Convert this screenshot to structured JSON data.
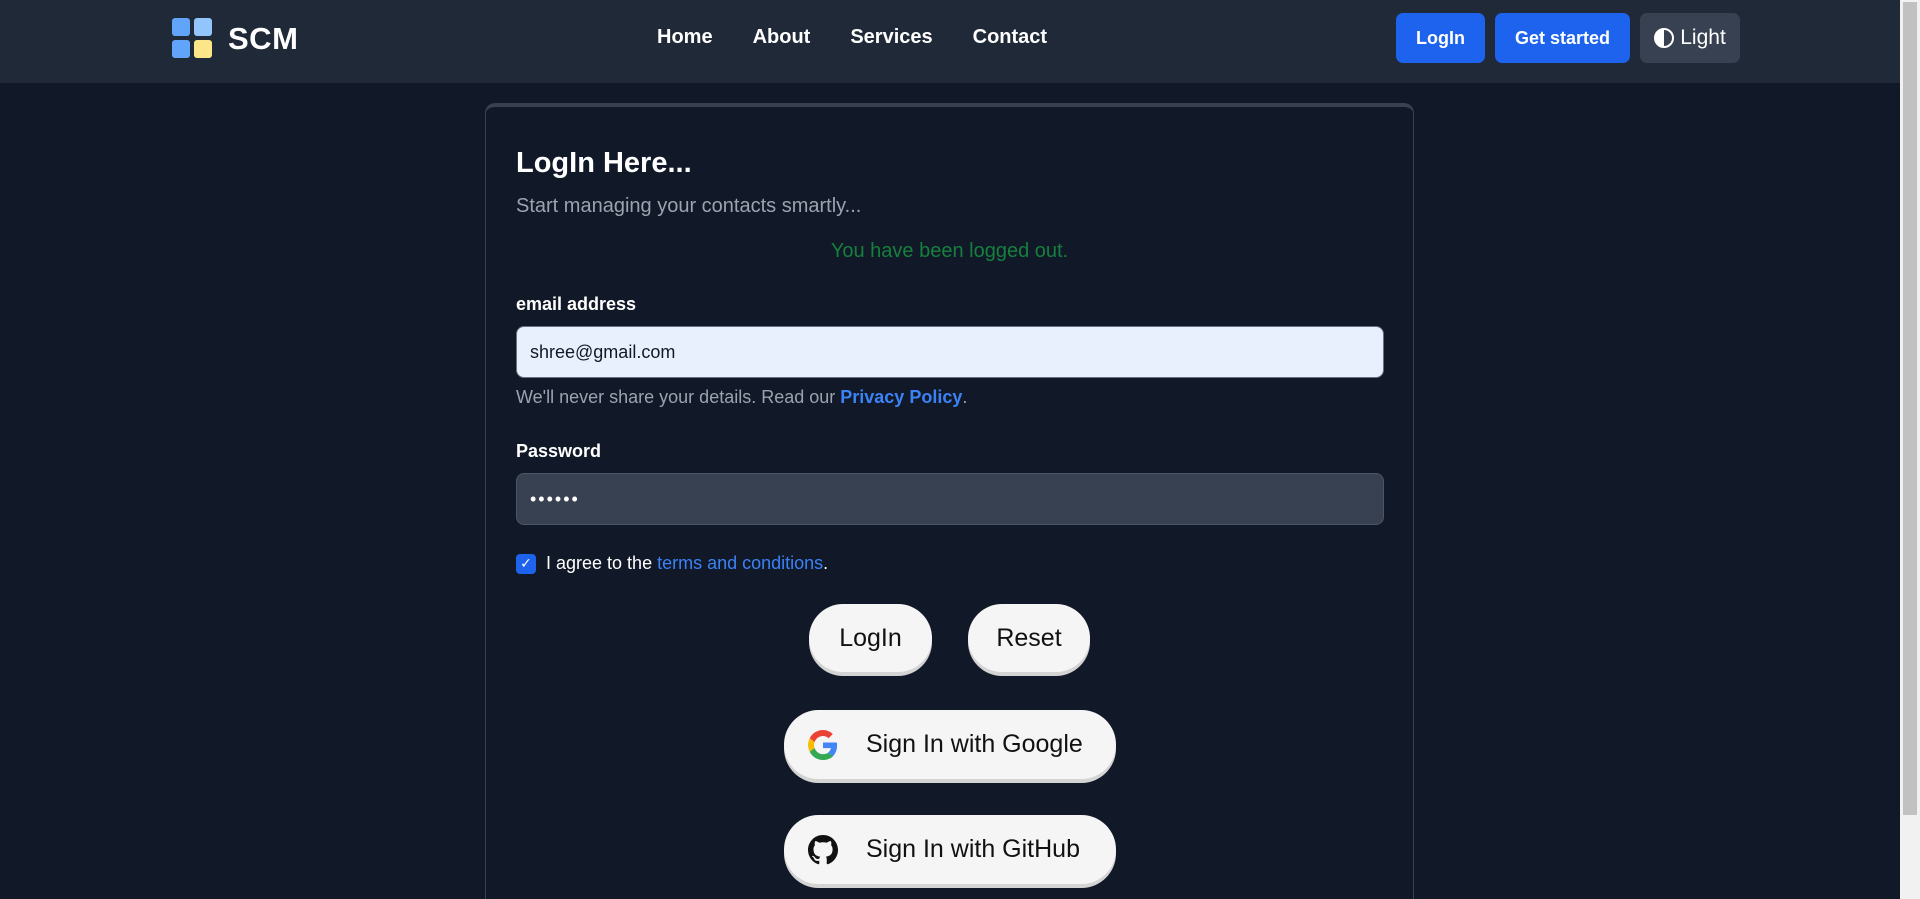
{
  "nav": {
    "brand": "SCM",
    "links": [
      "Home",
      "About",
      "Services",
      "Contact"
    ],
    "login_label": "LogIn",
    "get_started_label": "Get started",
    "theme_label": "Light"
  },
  "card": {
    "title": "LogIn Here...",
    "subtitle": "Start managing your contacts smartly...",
    "message": "You have been logged out.",
    "email_label": "email address",
    "email_value": "shree@gmail.com",
    "help_text": "We'll never share your details. Read our ",
    "privacy_link": "Privacy Policy",
    "help_suffix": ".",
    "password_label": "Password",
    "password_value": "••••••",
    "terms_prefix": "I agree to the ",
    "terms_link": "terms and conditions",
    "terms_suffix": ".",
    "login_button": "LogIn",
    "reset_button": "Reset",
    "google_button": "Sign In with Google",
    "github_button": "Sign In with GitHub"
  },
  "colors": {
    "accent": "#1d63ed",
    "background": "#111827",
    "navbar": "#1f2937",
    "success": "#15803d"
  },
  "icons": [
    "contacts-logo-icon",
    "theme-toggle-icon",
    "checkbox-check-icon",
    "google-icon",
    "github-icon"
  ]
}
